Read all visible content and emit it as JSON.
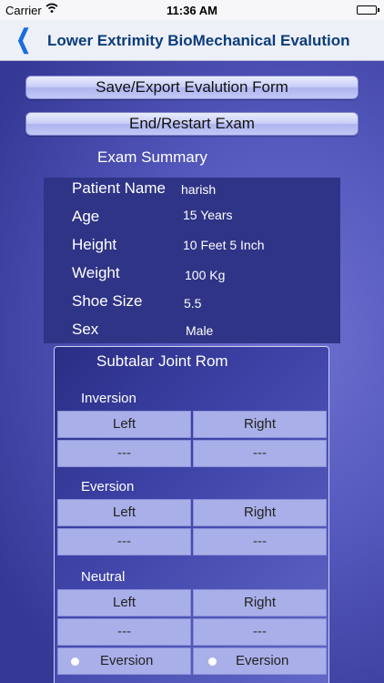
{
  "status_bar": {
    "carrier": "Carrier",
    "time": "11:36 AM"
  },
  "nav": {
    "back_icon": "chevron-left-icon",
    "title": "Lower Extrimity BioMechanical Evalution"
  },
  "buttons": {
    "save_export": "Save/Export Evalution Form",
    "end_restart": "End/Restart Exam"
  },
  "summary": {
    "title": "Exam Summary",
    "rows": [
      {
        "label": "Patient Name",
        "value": "harish"
      },
      {
        "label": "Age",
        "value": "15 Years"
      },
      {
        "label": "Height",
        "value": "10 Feet 5 Inch"
      },
      {
        "label": "Weight",
        "value": "100 Kg"
      },
      {
        "label": "Shoe Size",
        "value": "5.5"
      },
      {
        "label": "Sex",
        "value": "Male"
      }
    ]
  },
  "subtalar": {
    "title": "Subtalar Joint Rom",
    "inversion": {
      "label": "Inversion",
      "left_header": "Left",
      "right_header": "Right",
      "left_value": "---",
      "right_value": "---"
    },
    "eversion": {
      "label": "Eversion",
      "left_header": "Left",
      "right_header": "Right",
      "left_value": "---",
      "right_value": "---"
    },
    "neutral": {
      "label": "Neutral",
      "left_header": "Left",
      "right_header": "Right",
      "left_value": "---",
      "right_value": "---",
      "left_option": "Eversion",
      "right_option": "Eversion"
    }
  },
  "colors": {
    "nav_title": "#0b3d7a",
    "back_accent": "#1a6de0",
    "button_bg": "#c8cdf6",
    "panel": "#2f3486"
  }
}
